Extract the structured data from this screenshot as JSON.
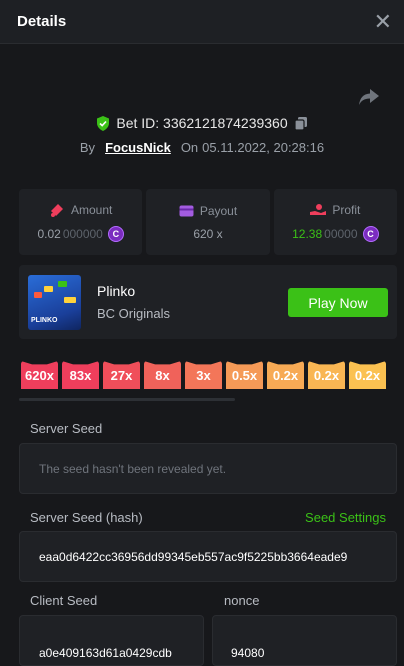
{
  "header": {
    "title": "Details"
  },
  "bet": {
    "bet_id": "Bet ID: 3362121874239360",
    "by_label": "By",
    "user": "FocusNick",
    "on_label": "On",
    "datetime": "05.11.2022, 20:28:16"
  },
  "stats": {
    "amount": {
      "label": "Amount",
      "value_main": "0.02",
      "value_dim": "000000"
    },
    "payout": {
      "label": "Payout",
      "value": "620 x"
    },
    "profit": {
      "label": "Profit",
      "value_main": "12.38",
      "value_dim": "00000"
    }
  },
  "game": {
    "thumb_label": "PLINKO",
    "name": "Plinko",
    "provider": "BC Originals",
    "play_label": "Play Now"
  },
  "multipliers": [
    {
      "label": "620x",
      "color": "#ef3e5c"
    },
    {
      "label": "83x",
      "color": "#ef3e5c"
    },
    {
      "label": "27x",
      "color": "#f04e5a"
    },
    {
      "label": "8x",
      "color": "#f0625a"
    },
    {
      "label": "3x",
      "color": "#f37659"
    },
    {
      "label": "0.5x",
      "color": "#f59a57"
    },
    {
      "label": "0.2x",
      "color": "#f7aa55"
    },
    {
      "label": "0.2x",
      "color": "#f9b653"
    },
    {
      "label": "0.2x",
      "color": "#fbc151"
    }
  ],
  "seeds": {
    "server_seed_label": "Server Seed",
    "server_seed_value": "The seed hasn't been revealed yet.",
    "hash_label": "Server Seed (hash)",
    "seed_settings": "Seed Settings",
    "hash_value": "eaa0d6422cc36956dd99345eb557ac9f5225bb3664eade9",
    "client_label": "Client Seed",
    "client_value": "a0e409163d61a0429cdb",
    "nonce_label": "nonce",
    "nonce_value": "94080"
  },
  "colors": {
    "accent": "#3bc117",
    "coin": "#7b2cbf"
  }
}
